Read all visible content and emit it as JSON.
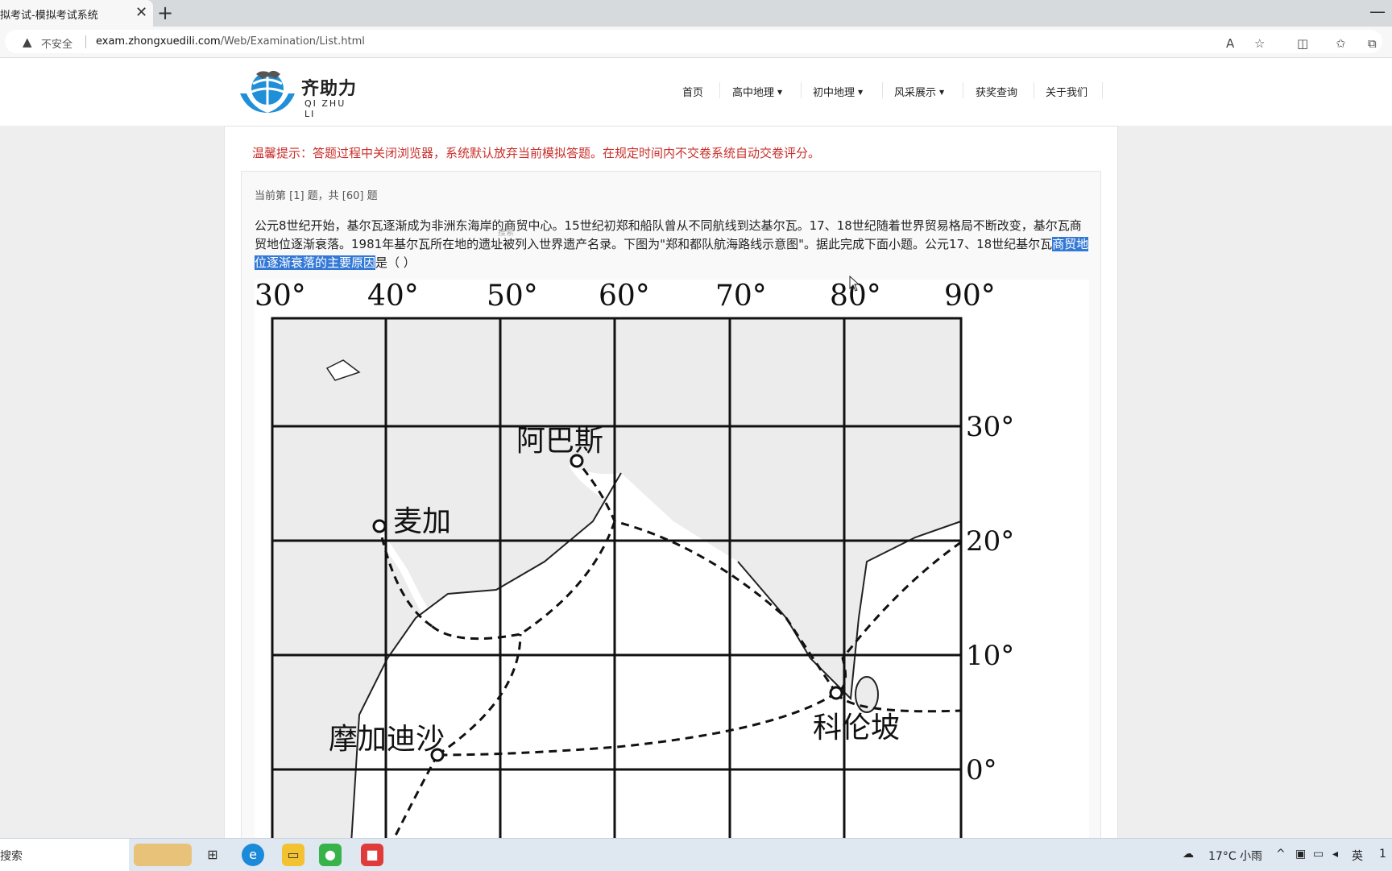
{
  "browser": {
    "tab_title": "拟考试-模拟考试系统",
    "insecure_label": "不安全",
    "url_host": "exam.zhongxuedili.com",
    "url_path": "/Web/Examination/List.html"
  },
  "site": {
    "logo_cn": "齐助力",
    "logo_en": "QI ZHU LI",
    "nav": {
      "home": "首页",
      "high_geo": "高中地理",
      "middle_geo": "初中地理",
      "showcase": "风采展示",
      "award": "获奖查询",
      "about": "关于我们"
    }
  },
  "exam": {
    "tip": "温馨提示：答题过程中关闭浏览器，系统默认放弃当前模拟答题。在规定时间内不交卷系统自动交卷评分。",
    "progress": "当前第 [1] 题，共 [60] 题",
    "question_before": "公元8世纪开始，基尔瓦逐渐成为非洲东海岸的商贸中心。15世纪初郑和船队曾从不同航线到达基尔瓦。17、18世纪随着世界贸易格局不断改变，基尔瓦商贸地位逐渐衰落。1981年基尔瓦所在地的遗址被列入世界遗产名录。下图为\"郑和都队航海路线示意图\"。据此完成下面小题。公元17、18世纪基尔瓦",
    "question_highlight": "商贸地位逐渐衰落的主要原因",
    "question_after": "是（ ）",
    "floating_search": "搜索"
  },
  "map": {
    "longitudes": [
      "30°",
      "40°",
      "50°",
      "60°",
      "70°",
      "80°",
      "90°"
    ],
    "latitudes": [
      "30°",
      "20°",
      "10°",
      "0°"
    ],
    "places": {
      "abbas": "阿巴斯",
      "mecca": "麦加",
      "mogadishu": "摩加迪沙",
      "colombo": "科伦坡"
    }
  },
  "taskbar": {
    "search_label": "搜索",
    "weather": "17°C 小雨",
    "ime": "英",
    "clock": "1"
  },
  "colors": {
    "tip_red": "#c9302c",
    "selection_blue": "#3478d6",
    "logo_blue": "#1f8fd8"
  }
}
